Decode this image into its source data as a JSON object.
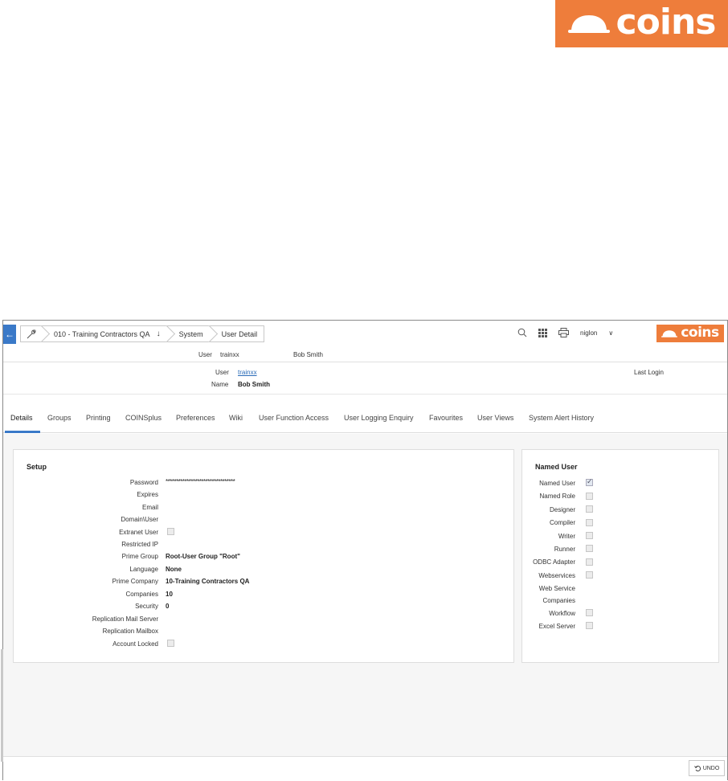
{
  "brand": {
    "name": "coins",
    "color": "#ee7d3b"
  },
  "topbar": {
    "back_icon": "arrow-left-icon",
    "breadcrumbs": [
      "010 - Training Contractors QA",
      "System",
      "User Detail"
    ],
    "breadcrumb_arrow": "↓",
    "user": "niglon",
    "user_caret": "∨"
  },
  "context": {
    "user_label": "User",
    "user_value": "trainxx",
    "name_value": "Bob Smith"
  },
  "header": {
    "user_label": "User",
    "user_value": "trainxx",
    "name_label": "Name",
    "name_value": "Bob Smith",
    "last_login_label": "Last Login"
  },
  "tabs": [
    "Details",
    "Groups",
    "Printing",
    "COINSplus",
    "Preferences",
    "Wiki",
    "User Function Access",
    "User Logging Enquiry",
    "Favourites",
    "User Views",
    "System Alert History"
  ],
  "setup": {
    "title": "Setup",
    "rows": [
      {
        "label": "Password",
        "value": "*********************************"
      },
      {
        "label": "Expires",
        "value": ""
      },
      {
        "label": "Email",
        "value": ""
      },
      {
        "label": "Domain\\User",
        "value": ""
      },
      {
        "label": "Extranet User",
        "checkbox": false
      },
      {
        "label": "Restricted IP",
        "value": ""
      },
      {
        "label": "Prime Group",
        "value": "Root-User Group \"Root\""
      },
      {
        "label": "Language",
        "value": "None"
      },
      {
        "label": "Prime Company",
        "value": "10-Training Contractors QA"
      },
      {
        "label": "Companies",
        "value": "10"
      },
      {
        "label": "Security",
        "value": "0"
      },
      {
        "label": "Replication Mail Server",
        "value": ""
      },
      {
        "label": "Replication Mailbox",
        "value": ""
      },
      {
        "label": "Account Locked",
        "checkbox": false
      }
    ]
  },
  "named_user": {
    "title": "Named User",
    "rows": [
      {
        "label": "Named User",
        "checked": true
      },
      {
        "label": "Named Role",
        "checked": false
      },
      {
        "label": "Designer",
        "checked": false
      },
      {
        "label": "Compiler",
        "checked": false
      },
      {
        "label": "Writer",
        "checked": false
      },
      {
        "label": "Runner",
        "checked": false
      },
      {
        "label": "ODBC Adapter",
        "checked": false
      },
      {
        "label": "Webservices",
        "checked": false
      },
      {
        "label": "Web Service",
        "checked": null
      },
      {
        "label": "Companies",
        "checked": null
      },
      {
        "label": "Workflow",
        "checked": false
      },
      {
        "label": "Excel Server",
        "checked": false
      }
    ]
  },
  "footer": {
    "undo_label": "UNDO"
  }
}
